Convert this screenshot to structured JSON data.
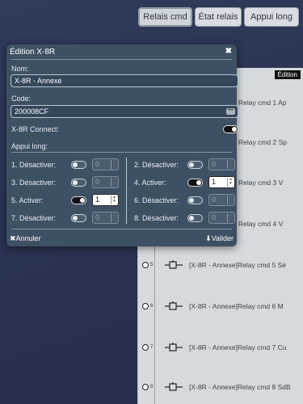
{
  "top_buttons": [
    "Relais cmd",
    "État relais",
    "Appui long"
  ],
  "list": {
    "edition_tag": "Édition",
    "peek_rows": [
      {
        "text": "Relay cmd 1 Ap"
      },
      {
        "text": "Relay cmd 2 Sp"
      },
      {
        "text": "Relay cmd 3 V"
      },
      {
        "text": "Relay cmd 4 V"
      }
    ],
    "rows": [
      {
        "num": "5",
        "text": "[X-8R - Annexe]Relay cmd 5 Sé"
      },
      {
        "num": "6",
        "text": "[X-8R - Annexe]Relay cmd 6 M"
      },
      {
        "num": "7",
        "text": "[X-8R - Annexe]Relay cmd 7 Cu"
      },
      {
        "num": "8",
        "text": "[X-8R - Annexe]Relay cmd 8 SdB"
      }
    ]
  },
  "dialog": {
    "title": "Édition X-8R",
    "close_icon": "close-icon",
    "nom_label": "Nom:",
    "nom_value": "X-8R - Annexe",
    "code_label": "Code:",
    "code_value": "200008CF",
    "connect_label": "X-8R Connect:",
    "connect_on": true,
    "appui_long_label": "Appui long:",
    "appui": [
      {
        "label": "1. Désactiver:",
        "on": false,
        "value": "0"
      },
      {
        "label": "2. Désactiver:",
        "on": false,
        "value": "0"
      },
      {
        "label": "3. Désactiver:",
        "on": false,
        "value": "0"
      },
      {
        "label": "4. Activer:",
        "on": true,
        "value": "1"
      },
      {
        "label": "5. Activer:",
        "on": true,
        "value": "1"
      },
      {
        "label": "6. Désactiver:",
        "on": false,
        "value": "0"
      },
      {
        "label": "7. Désactiver:",
        "on": false,
        "value": "0"
      },
      {
        "label": "8. Désactiver:",
        "on": false,
        "value": "0"
      }
    ],
    "cancel_label": "✖Annuler",
    "validate_label": "⬇Valider"
  }
}
